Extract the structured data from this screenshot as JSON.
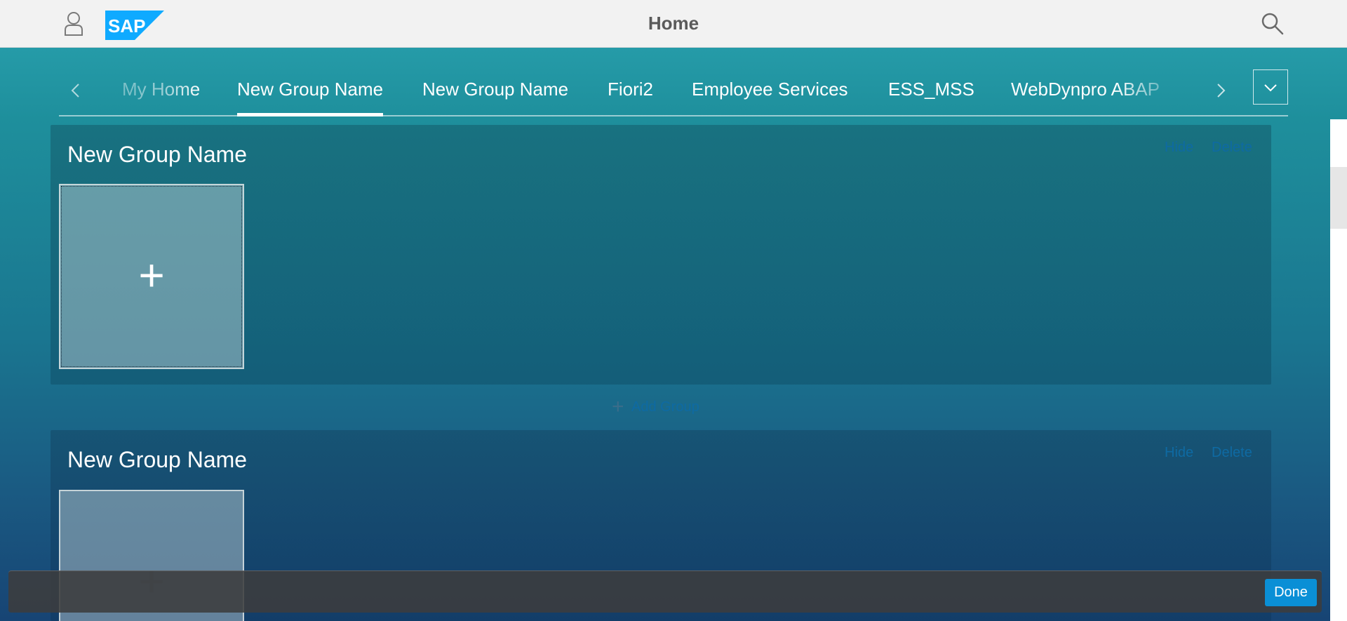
{
  "header": {
    "title": "Home",
    "logo_text": "SAP",
    "brand_color": "#0faaff"
  },
  "anchor_nav": {
    "tabs": [
      {
        "label": "My Home",
        "active": false
      },
      {
        "label": "New Group Name",
        "active": true
      },
      {
        "label": "New Group Name",
        "active": false
      },
      {
        "label": "Fiori2",
        "active": false
      },
      {
        "label": "Employee Services",
        "active": false
      },
      {
        "label": "ESS_MSS",
        "active": false
      },
      {
        "label": "WebDynpro ABAP",
        "active": false
      }
    ]
  },
  "groups": [
    {
      "title": "New Group Name",
      "hide_label": "Hide",
      "delete_label": "Delete",
      "tile_symbol": "+"
    },
    {
      "title": "New Group Name",
      "hide_label": "Hide",
      "delete_label": "Delete",
      "tile_symbol": "+"
    }
  ],
  "add_group": {
    "symbol": "+",
    "label": "Add Group"
  },
  "footer": {
    "done_label": "Done",
    "accent": "#0a8fd6"
  },
  "icons": {
    "user": "user-icon",
    "search": "search-icon",
    "nav_left": "chevron-left-icon",
    "nav_right": "chevron-right-icon",
    "overflow": "chevron-down-icon"
  }
}
